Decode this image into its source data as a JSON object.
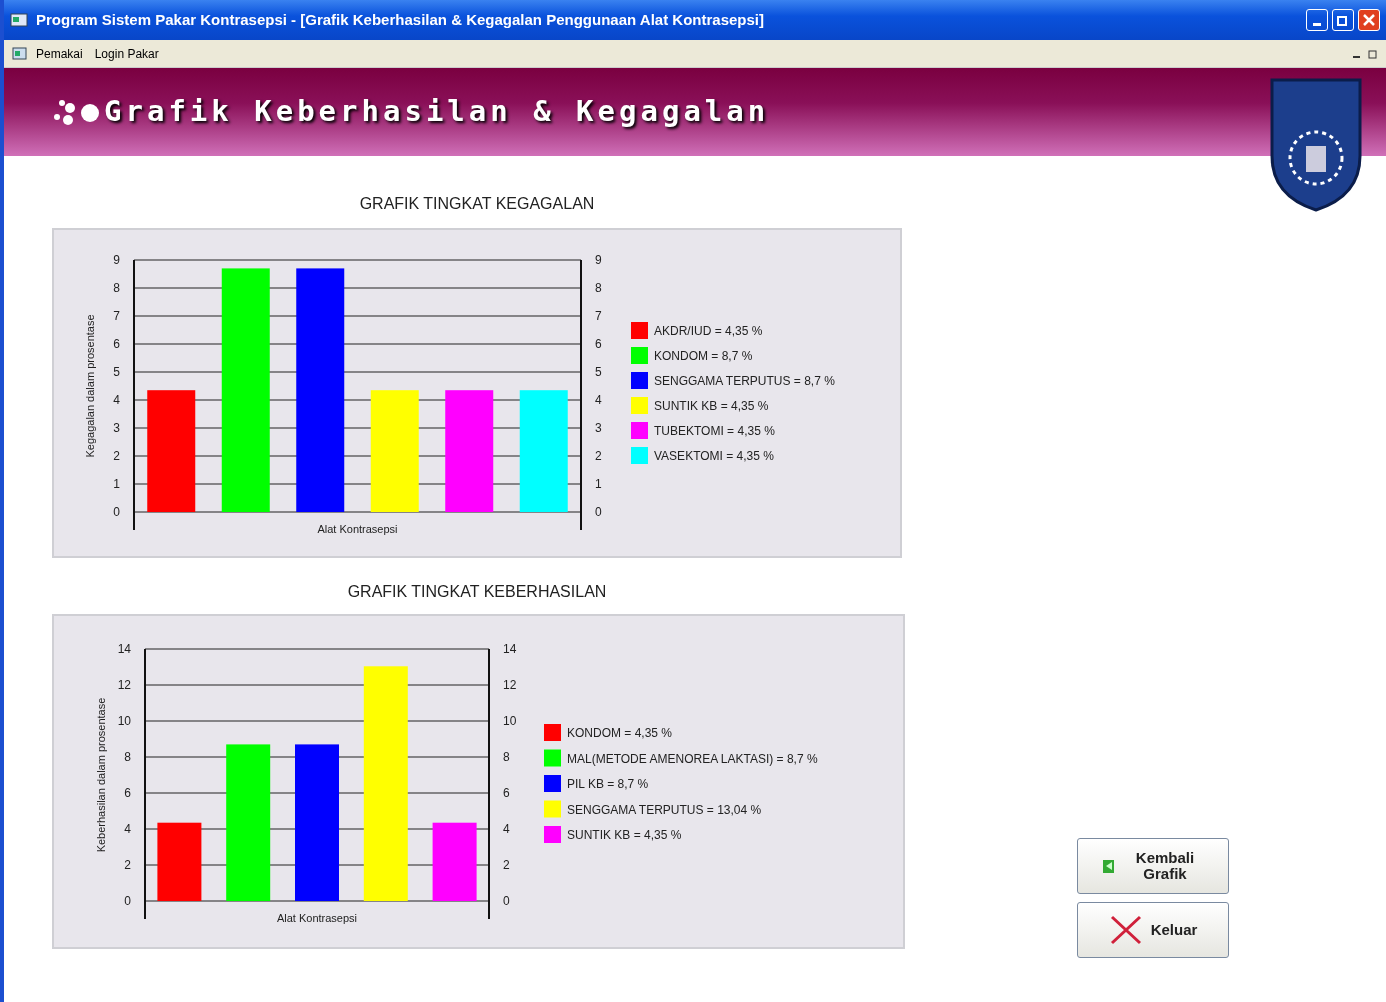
{
  "window": {
    "title": "Program Sistem Pakar Kontrasepsi - [Grafik Keberhasilan & Kegagalan Penggunaan Alat Kontrasepsi]"
  },
  "menu": [
    {
      "label": "Pemakai"
    },
    {
      "label": "Login Pakar"
    }
  ],
  "banner": {
    "title": "Grafik Keberhasilan & Kegagalan"
  },
  "charts": [
    {
      "title": "GRAFIK TINGKAT KEGAGALAN",
      "chart_data": {
        "type": "bar",
        "xlabel": "Alat Kontrasepsi",
        "ylabel": "Kegagalan dalam prosentase",
        "ylim": [
          0,
          9
        ],
        "yticks": [
          0,
          1,
          2,
          3,
          4,
          5,
          6,
          7,
          8,
          9
        ],
        "y2lim": [
          0,
          9
        ],
        "y2ticks": [
          0,
          1,
          2,
          3,
          4,
          5,
          6,
          7,
          8,
          9
        ],
        "grid": true,
        "legend": true,
        "series": [
          {
            "name": "AKDR/IUD = 4,35 %",
            "color": "#ff0000",
            "values": [
              4.35
            ]
          },
          {
            "name": "KONDOM = 8,7 %",
            "color": "#00ff00",
            "values": [
              8.7
            ]
          },
          {
            "name": "SENGGAMA TERPUTUS = 8,7 %",
            "color": "#0000ff",
            "values": [
              8.7
            ]
          },
          {
            "name": "SUNTIK KB = 4,35 %",
            "color": "#ffff00",
            "values": [
              4.35
            ]
          },
          {
            "name": "TUBEKTOMI = 4,35 %",
            "color": "#ff00ff",
            "values": [
              4.35
            ]
          },
          {
            "name": "VASEKTOMI = 4,35 %",
            "color": "#00ffff",
            "values": [
              4.35
            ]
          }
        ]
      }
    },
    {
      "title": "GRAFIK TINGKAT KEBERHASILAN",
      "chart_data": {
        "type": "bar",
        "xlabel": "Alat Kontrasepsi",
        "ylabel": "Keberhasilan dalam prosentase",
        "ylim": [
          0,
          14
        ],
        "yticks": [
          0,
          2,
          4,
          6,
          8,
          10,
          12,
          14
        ],
        "y2lim": [
          0,
          14
        ],
        "y2ticks": [
          0,
          2,
          4,
          6,
          8,
          10,
          12,
          14
        ],
        "grid": true,
        "legend": true,
        "series": [
          {
            "name": "KONDOM = 4,35 %",
            "color": "#ff0000",
            "values": [
              4.35
            ]
          },
          {
            "name": "MAL(METODE AMENOREA LAKTASI) = 8,7 %",
            "color": "#00ff00",
            "values": [
              8.7
            ]
          },
          {
            "name": "PIL KB = 8,7 %",
            "color": "#0000ff",
            "values": [
              8.7
            ]
          },
          {
            "name": "SENGGAMA TERPUTUS = 13,04 %",
            "color": "#ffff00",
            "values": [
              13.04
            ]
          },
          {
            "name": "SUNTIK KB = 4,35 %",
            "color": "#ff00ff",
            "values": [
              4.35
            ]
          }
        ]
      }
    }
  ],
  "buttons": [
    {
      "label": "Kembali Grafik",
      "kind": "back"
    },
    {
      "label": "Keluar",
      "kind": "exit"
    }
  ]
}
